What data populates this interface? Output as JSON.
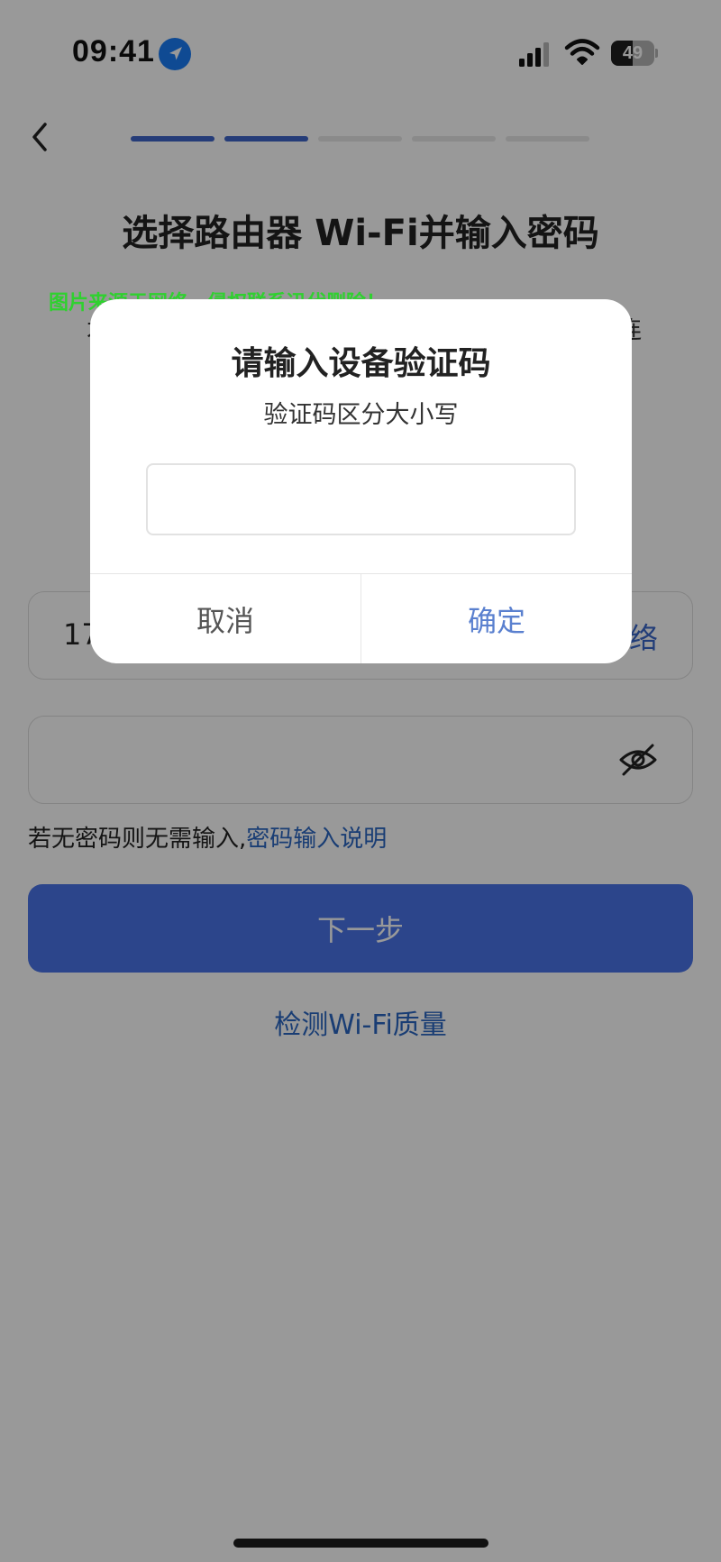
{
  "status_bar": {
    "time": "09:41",
    "battery": "49",
    "battery_level": 0.49
  },
  "header": {
    "steps": [
      {
        "active": true
      },
      {
        "active": true
      },
      {
        "active": false
      },
      {
        "active": false
      },
      {
        "active": false
      }
    ],
    "title": "选择路由器 Wi-Fi并输入密码"
  },
  "watermark": "图片来源于网络，侵权联系迅代删除！",
  "hint_fragments": {
    "left": "才",
    "right": "连"
  },
  "form": {
    "wifi_name_partial": "17",
    "switch_network_partial": "络",
    "password_value": "",
    "password_hint": "若无密码则无需输入,",
    "password_hint_link": "密码输入说明",
    "next_button": "下一步",
    "quality_link": "检测Wi-Fi质量"
  },
  "dialog": {
    "title": "请输入设备验证码",
    "subtitle": "验证码区分大小写",
    "input_value": "",
    "cancel": "取消",
    "confirm": "确定"
  },
  "colors": {
    "accent": "#3e64c8",
    "link": "#2b66c2",
    "watermark": "#2fd12f",
    "confirm": "#5a80cf"
  }
}
